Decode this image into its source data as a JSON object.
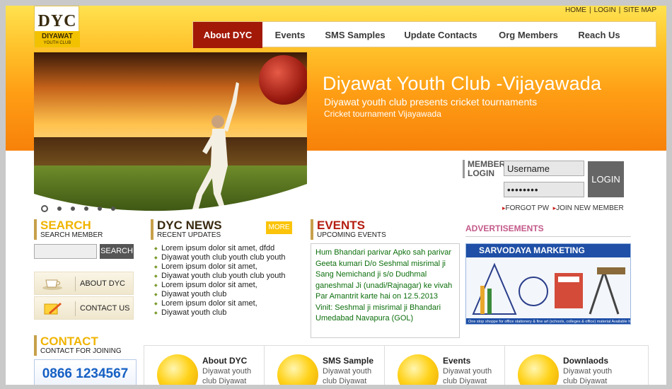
{
  "site": {
    "logo_main": "DYC",
    "logo_sub1": "DIYAWAT",
    "logo_sub2": "YOUTH CLUB"
  },
  "top_links": [
    "HOME",
    "LOGIN",
    "SITE MAP"
  ],
  "nav": {
    "items": [
      {
        "label": "About DYC",
        "active": true
      },
      {
        "label": "Events",
        "active": false
      },
      {
        "label": "SMS Samples",
        "active": false
      },
      {
        "label": "Update Contacts",
        "active": false
      },
      {
        "label": "Org Members",
        "active": false
      },
      {
        "label": "Reach Us",
        "active": false
      }
    ],
    "active_color": "#a31908"
  },
  "banner": {
    "title": "Diyawat Youth Club -Vijayawada",
    "subtitle": "Diyawat youth club presents cricket tournaments",
    "line3": "Cricket tournament Vijayawada",
    "slide_count": 6,
    "active_slide": 1
  },
  "login": {
    "label_line1": "MEMBER",
    "label_line2": "LOGIN",
    "username_value": "Username",
    "password_value": "••••••••",
    "button_label": "LOGIN",
    "forgot_label": "FORGOT PW",
    "join_label": "JOIN NEW MEMBER"
  },
  "search": {
    "title": "SEARCH",
    "subtitle": "SEARCH MEMBER",
    "button_label": "SEARCH",
    "input_value": ""
  },
  "side_links": [
    {
      "label": "ABOUT DYC",
      "icon": "teacup-icon"
    },
    {
      "label": "CONTACT US",
      "icon": "pencil-note-icon"
    }
  ],
  "contact": {
    "title": "CONTACT",
    "subtitle": "CONTACT FOR JOINING",
    "phone": "0866 1234567"
  },
  "news": {
    "title": "DYC NEWS",
    "subtitle": "RECENT UPDATES",
    "more_label": "MORE",
    "items": [
      "Lorem ipsum dolor sit amet, dfdd",
      "Diyawat youth club youth club youth",
      "Lorem ipsum dolor sit amet,",
      "Diyawat youth club youth club youth",
      "Lorem ipsum dolor sit amet,",
      "Diyawat youth club",
      "Lorem ipsum dolor sit amet,",
      "Diyawat youth club"
    ]
  },
  "events": {
    "title": "EVENTS",
    "subtitle": "UPCOMING EVENTS",
    "body": "Hum Bhandari parivar Apko sah parivar Geeta kumari D/o Seshmal misrimal ji Sang Nemichand ji s/o Dudhmal ganeshmal Ji (unadi/Rajnagar) ke vivah Par Amantrit karte hai on 12.5.2013 Vinit: Seshmal ji misrimal ji Bhandari Umedabad Navapura (GOL)"
  },
  "ads": {
    "title": "ADVERTISEMENTS",
    "banner_text": "SARVODAYA MARKETING",
    "footer_text": "One stop shoppe for office stationery & fine art (schools, colleges & office) material Available here..."
  },
  "features": [
    {
      "title": "About DYC",
      "desc": "Diyawat youth club Diyawat",
      "icon": "computer-icon"
    },
    {
      "title": "SMS Sample",
      "desc": "Diyawat youth club Diyawat",
      "icon": "phone-icon"
    },
    {
      "title": "Events",
      "desc": "Diyawat youth club Diyawat",
      "icon": "people-icon"
    },
    {
      "title": "Downlaods",
      "desc": "Diyawat youth club Diyawat",
      "icon": "documents-icon"
    }
  ]
}
